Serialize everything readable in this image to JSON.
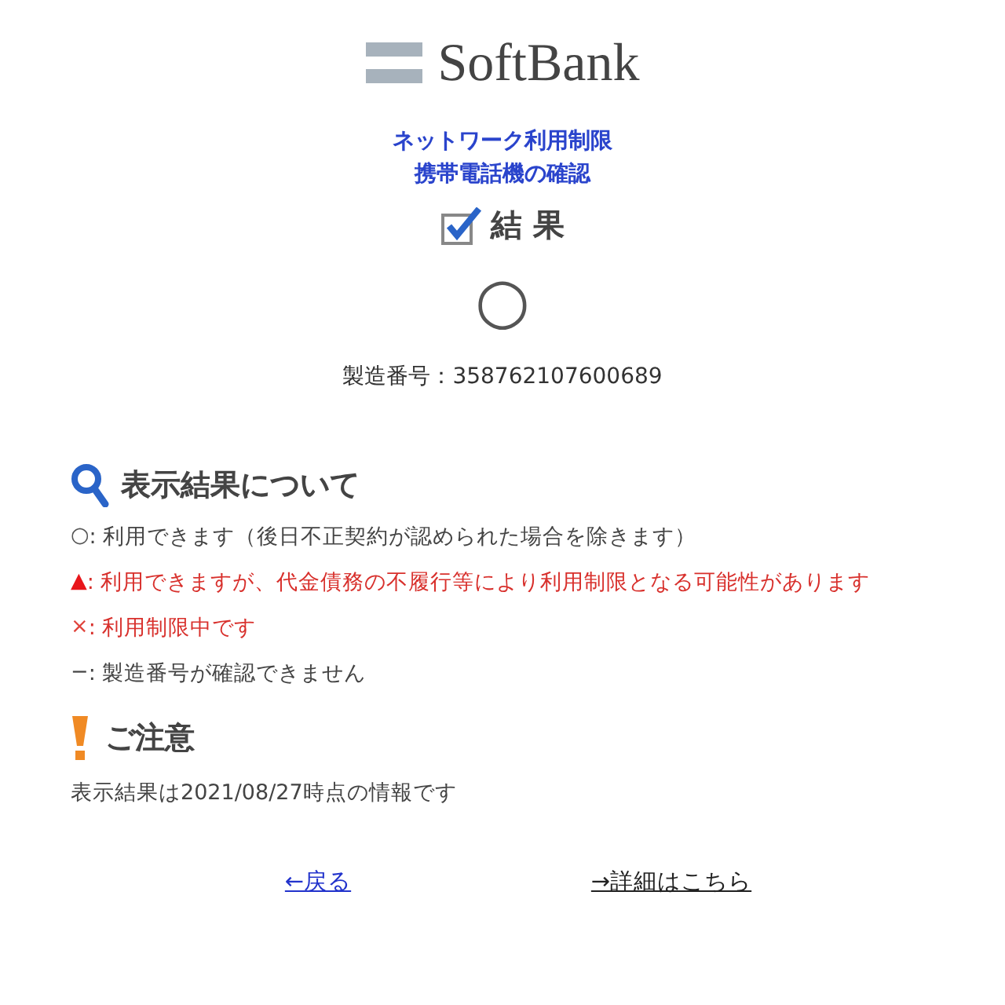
{
  "logo": {
    "text": "SoftBank"
  },
  "title_lines": [
    "ネットワーク利用制限",
    "携帯電話機の確認"
  ],
  "result": {
    "heading": "結 果",
    "symbol": "○"
  },
  "serial": "製造番号：358762107600689",
  "legend": {
    "heading": "表示結果について",
    "items": [
      {
        "kind": "ok",
        "symbol": "○",
        "text": ": 利用できます（後日不正契約が認められた場合を除きます）"
      },
      {
        "kind": "warn",
        "symbol": "▲",
        "text": ": 利用できますが、代金債務の不履行等により利用制限となる可能性があります"
      },
      {
        "kind": "ng",
        "symbol": "×",
        "text": ": 利用制限中です"
      },
      {
        "kind": "unknown",
        "symbol": "−",
        "text": ": 製造番号が確認できません"
      }
    ]
  },
  "notice": {
    "heading": "ご注意",
    "text": "表示結果は2021/08/27時点の情報です"
  },
  "links": [
    {
      "label": "←戻る",
      "visited": false
    },
    {
      "label": "→詳細はこちら",
      "visited": true
    }
  ]
}
